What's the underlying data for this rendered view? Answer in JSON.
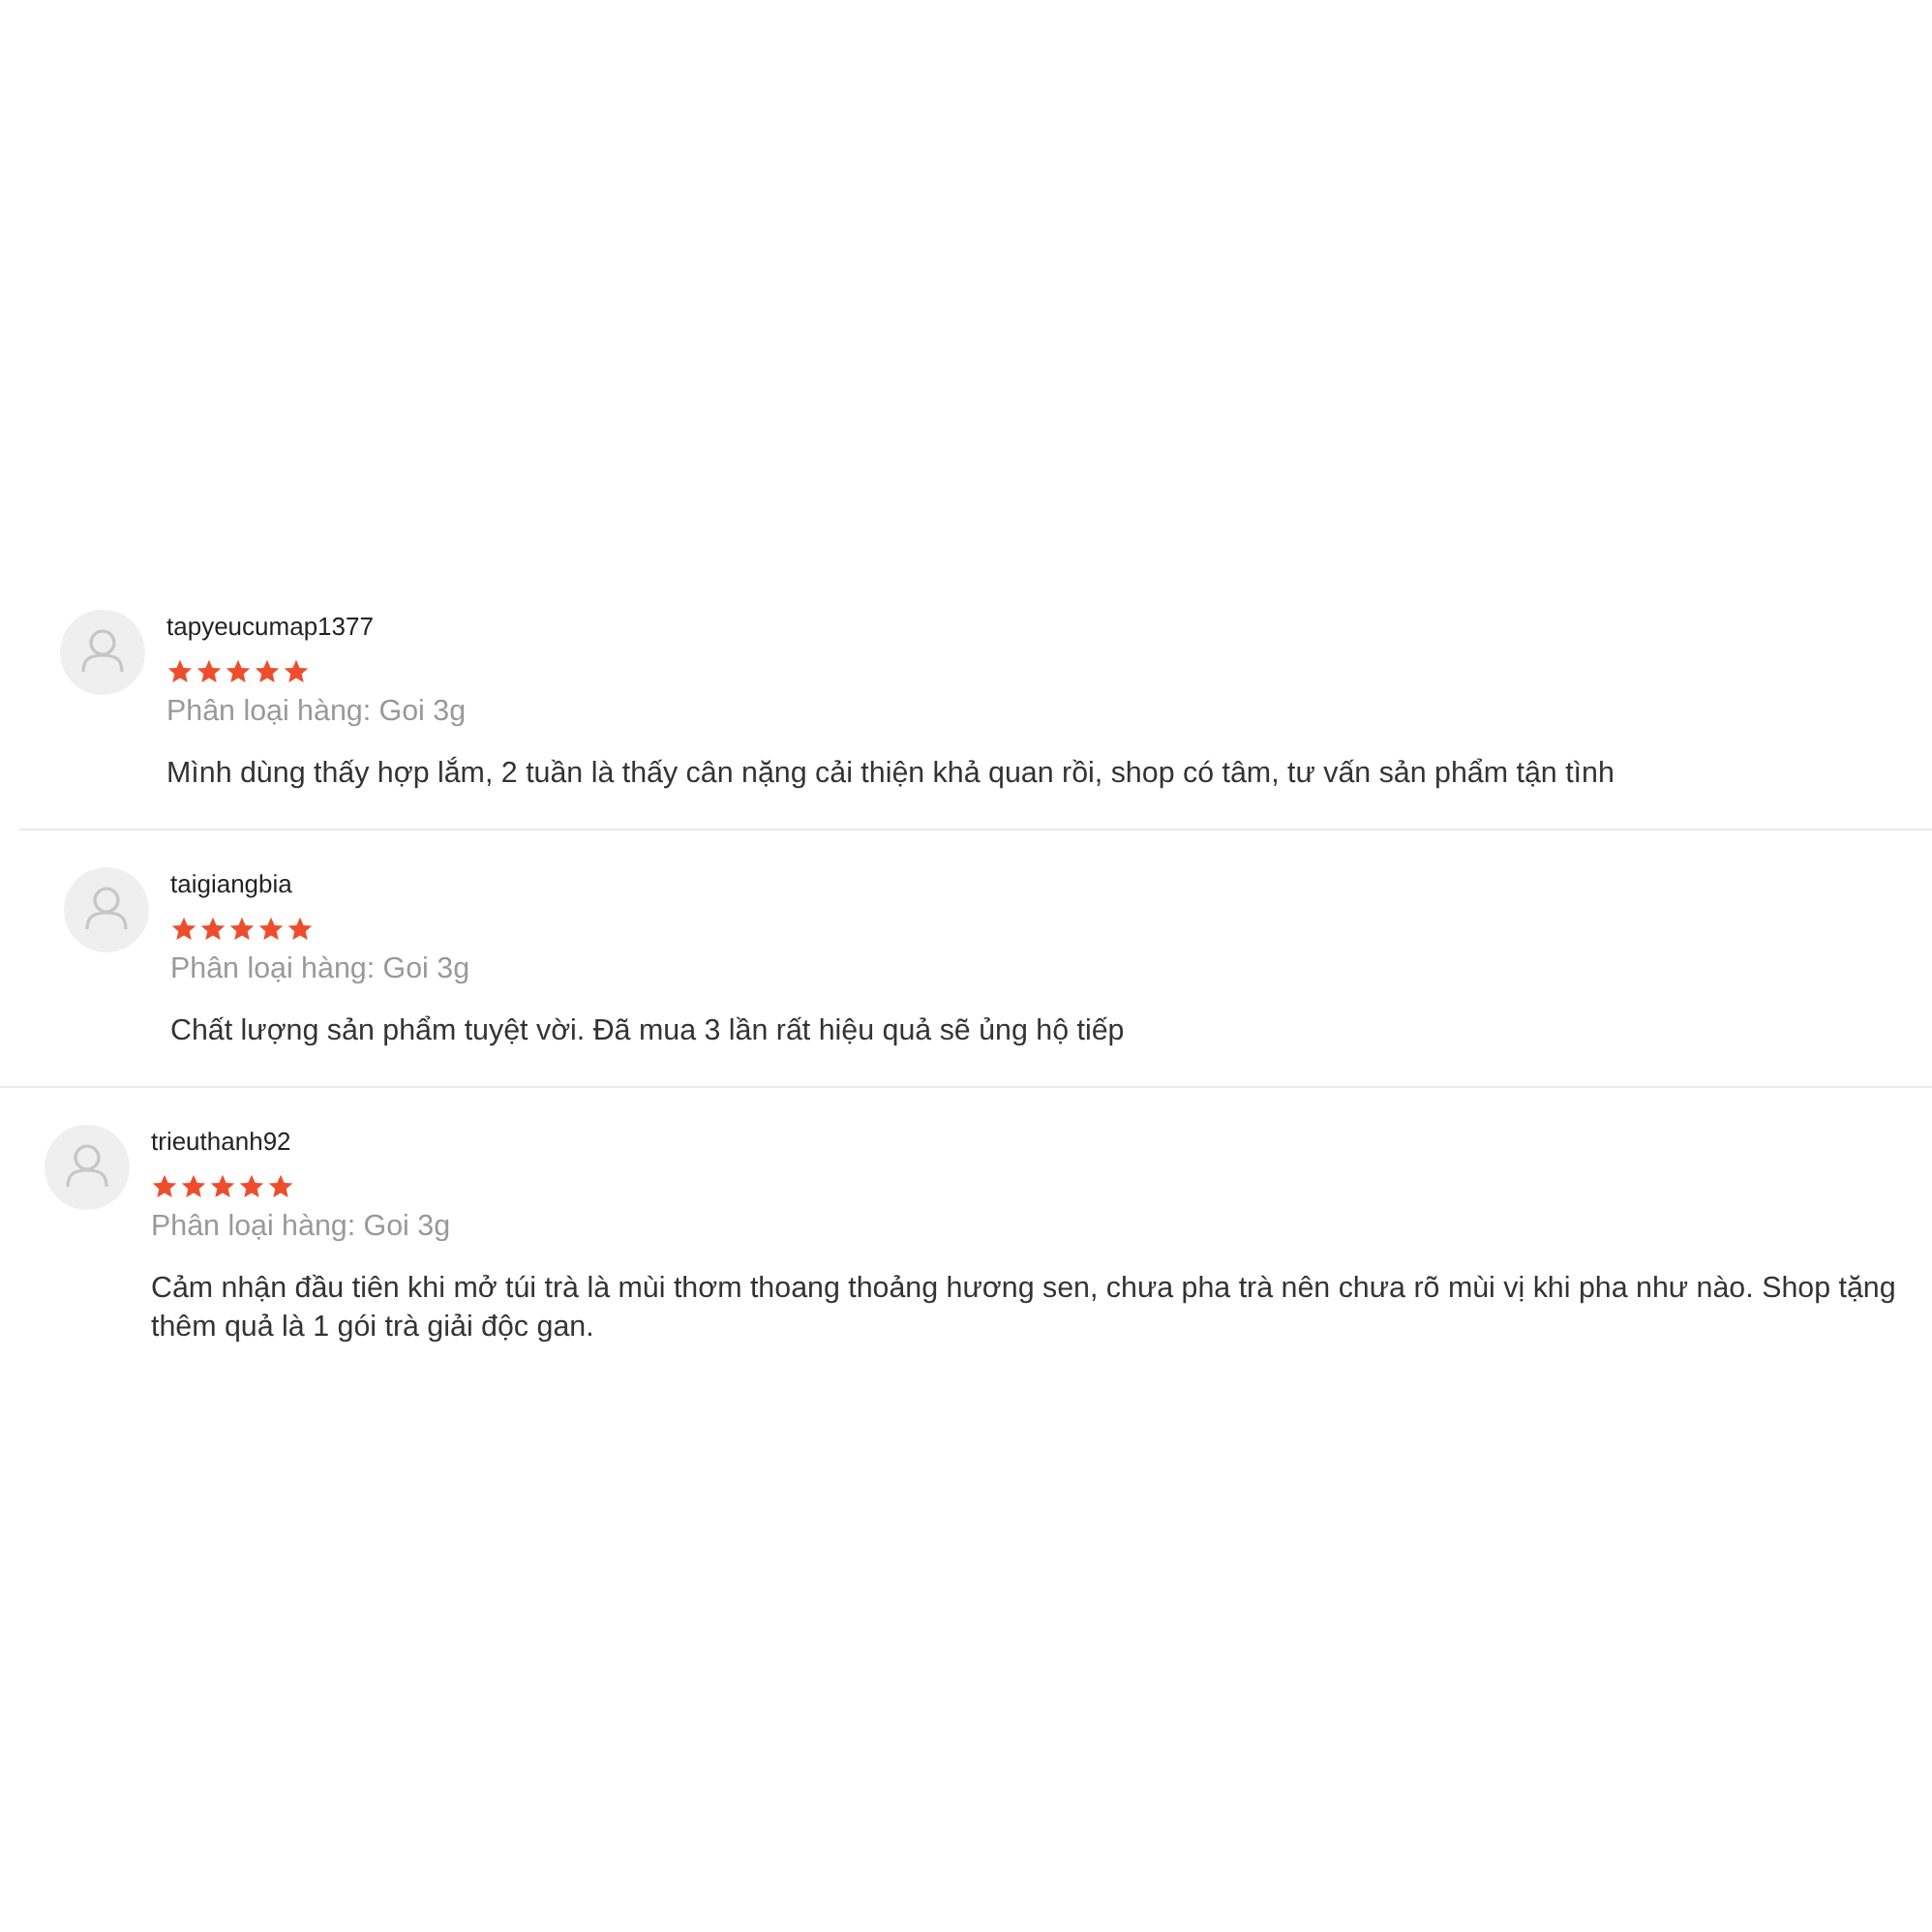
{
  "reviews": [
    {
      "username": "tapyeucumap1377",
      "stars": 5,
      "variant": "Phân loại hàng: Goi 3g",
      "comment": "Mình dùng thấy hợp lắm, 2 tuần là thấy cân nặng cải thiện khả quan rồi, shop có tâm, tư vấn sản phẩm tận tình"
    },
    {
      "username": "taigiangbia",
      "stars": 5,
      "variant": "Phân loại hàng: Goi 3g",
      "comment": "Chất lượng sản phẩm tuyệt vời. Đã mua 3 lần rất hiệu quả sẽ ủng hộ tiếp"
    },
    {
      "username": "trieuthanh92",
      "stars": 5,
      "variant": "Phân loại hàng: Goi 3g",
      "comment": "Cảm nhận đầu tiên khi mở túi trà là mùi thơm thoang thoảng hương sen, chưa pha trà nên chưa rõ mùi vị khi pha như nào. Shop tặng thêm quả là 1 gói trà giải độc gan."
    }
  ]
}
